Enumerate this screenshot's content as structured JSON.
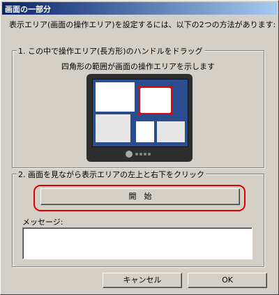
{
  "window": {
    "title": "画面の一部分"
  },
  "intro": "表示エリア(画面の操作エリア)を設定するには、以下の2つの方法があります:",
  "group1": {
    "legend": "1. この中で操作エリア(長方形)のハンドルをドラッグ",
    "description": "四角形の範囲が画面の操作エリアを示します"
  },
  "group2": {
    "legend": "2. 画面を見ながら表示エリアの左上と右下をクリック",
    "start_label": "開　始",
    "message_label": "メッセージ:",
    "message_value": ""
  },
  "buttons": {
    "cancel": "キャンセル",
    "ok": "OK"
  },
  "colors": {
    "titlebar_start": "#0a246a",
    "titlebar_end": "#a6caf0",
    "highlight": "#e00000",
    "selection": "#d01010"
  }
}
